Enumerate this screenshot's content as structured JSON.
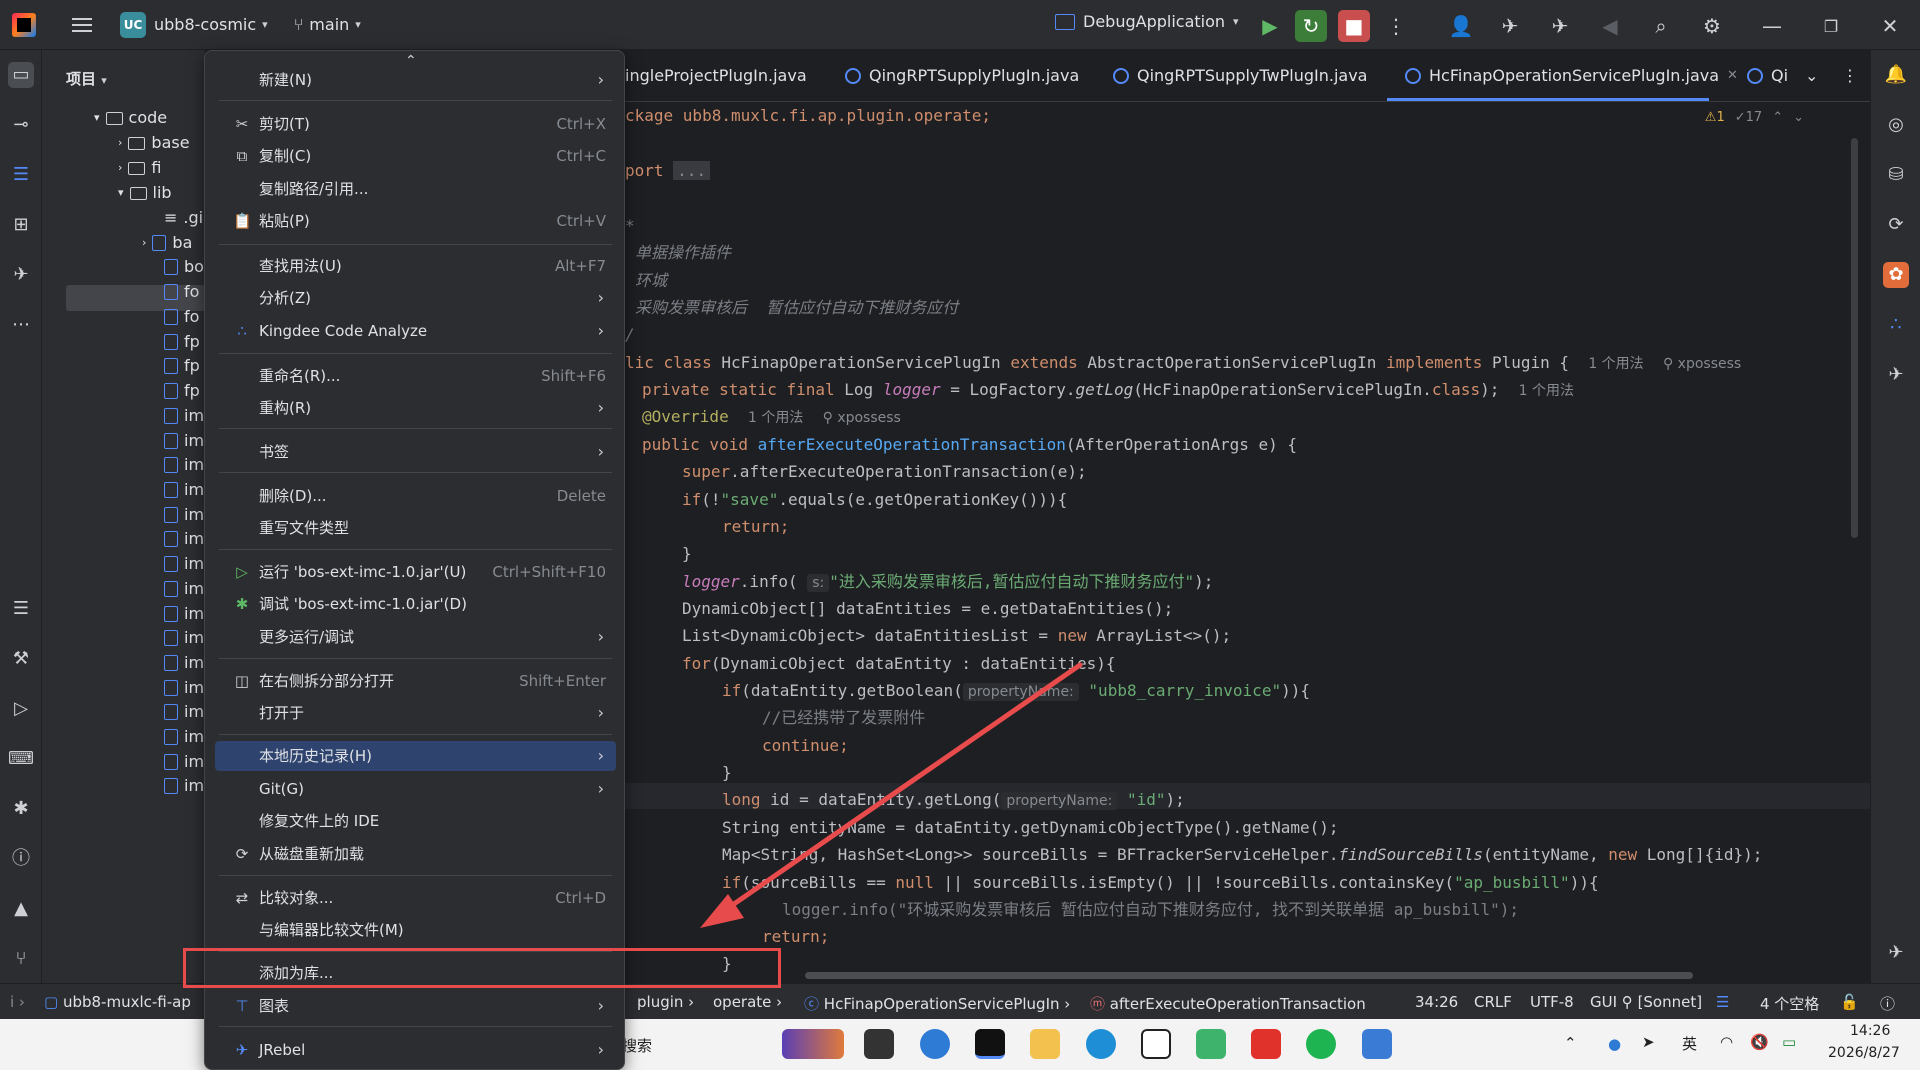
{
  "titlebar": {
    "project_badge": "UC",
    "project_name": "ubb8-cosmic",
    "branch": "main",
    "run_config": "DebugApplication"
  },
  "project_panel": {
    "header": "项目",
    "tree": [
      {
        "label": "code"
      },
      {
        "label": "base"
      },
      {
        "label": "fi"
      },
      {
        "label": "lib"
      },
      {
        "label": ".gi"
      },
      {
        "label": "ba"
      },
      {
        "label": "bo"
      },
      {
        "label": "fo"
      },
      {
        "label": "fo"
      },
      {
        "label": "fp"
      },
      {
        "label": "fp"
      },
      {
        "label": "fp"
      },
      {
        "label": "im"
      },
      {
        "label": "im"
      },
      {
        "label": "im"
      },
      {
        "label": "im"
      },
      {
        "label": "im"
      },
      {
        "label": "im"
      },
      {
        "label": "im"
      },
      {
        "label": "im"
      },
      {
        "label": "im"
      },
      {
        "label": "im"
      },
      {
        "label": "im"
      },
      {
        "label": "im"
      },
      {
        "label": "im"
      },
      {
        "label": "im"
      },
      {
        "label": "im"
      },
      {
        "label": "im"
      }
    ]
  },
  "tabs": [
    {
      "label": "ingleProjectPlugIn.java"
    },
    {
      "label": "QingRPTSupplyPlugIn.java"
    },
    {
      "label": "QingRPTSupplyTwPlugIn.java"
    },
    {
      "label": "HcFinapOperationServicePlugIn.java"
    },
    {
      "label": "Qi"
    }
  ],
  "inspections": {
    "warnings": "1",
    "weak": "17"
  },
  "code": {
    "l1": "ckage ubb8.muxlc.fi.ap.plugin.operate;",
    "l2": "port",
    "l2b": "...",
    "l3": "*",
    "l4": "单据操作插件",
    "l5": "环城",
    "l6": "采购发票审核后  暂估应付自动下推财务应付",
    "l7": "/",
    "l8a": "lic class",
    "l8b": " HcFinapOperationServicePlugIn ",
    "l8c": "extends",
    "l8d": " AbstractOperationServicePlugIn ",
    "l8e": "implements",
    "l8f": " Plugin {",
    "l8g": "1 个用法",
    "l8h": "xpossess",
    "l9a": "private static final",
    "l9b": " Log ",
    "l9c": "logger",
    "l9d": " = LogFactory.",
    "l9e": "getLog",
    "l9f": "(HcFinapOperationServicePlugIn.",
    "l9g": "class",
    "l9h": ");",
    "l9i": "1 个用法",
    "l10a": "@Override",
    "l10b": "1 个用法",
    "l10c": "xpossess",
    "l11a": "public void",
    "l11b": " afterExecuteOperationTransaction",
    "l11c": "(AfterOperationArgs e) {",
    "l12a": "super",
    "l12b": ".afterExecuteOperationTransaction(e);",
    "l13a": "if",
    "l13b": "(!",
    "l13c": "\"save\"",
    "l13d": ".equals(e.getOperationKey())){",
    "l14": "return;",
    "l15": "}",
    "l16a": "logger",
    "l16b": ".info(",
    "l16c": "s:",
    "l16d": "\"进入采购发票审核后,暂估应付自动下推财务应付\"",
    "l16e": ");",
    "l17": "DynamicObject[] dataEntities = e.getDataEntities();",
    "l18a": "List<DynamicObject> dataEntitiesList = ",
    "l18b": "new",
    "l18c": " ArrayList<>();",
    "l19a": "for",
    "l19b": "(DynamicObject dataEntity : dataEntities){",
    "l20a": "if",
    "l20b": "(dataEntity.getBoolean(",
    "l20c": "propertyName:",
    "l20d": "\"ubb8_carry_invoice\"",
    "l20e": ")){",
    "l21": "//已经携带了发票附件",
    "l22": "continue;",
    "l23": "}",
    "l24a": "long",
    "l24b": " id = dataEntity.getLong(",
    "l24c": "propertyName:",
    "l24d": "\"id\"",
    "l24e": ");",
    "l25": "String entityName = dataEntity.getDynamicObjectType().getName();",
    "l26a": "Map<String, HashSet<Long>> sourceBills = BFTrackerServiceHelper.",
    "l26b": "findSourceBills",
    "l26c": "(entityName, ",
    "l26d": "new",
    "l26e": " Long[]{id});",
    "l27a": "if",
    "l27b": "(sourceBills == ",
    "l27c": "null",
    "l27d": " || sourceBills.isEmpty() || !sourceBills.containsKey(",
    "l27e": "\"ap_busbill\"",
    "l27f": ")){",
    "l28": "logger.info(\"环城采购发票审核后 暂估应付自动下推财务应付, 找不到关联单据 ap_busbill\");",
    "l29": "return;",
    "l30": "}"
  },
  "context_menu": {
    "items": [
      {
        "label": "新建(N)"
      },
      {
        "label": "剪切(T)",
        "shortcut": "Ctrl+X"
      },
      {
        "label": "复制(C)",
        "shortcut": "Ctrl+C"
      },
      {
        "label": "复制路径/引用..."
      },
      {
        "label": "粘贴(P)",
        "shortcut": "Ctrl+V"
      },
      {
        "label": "查找用法(U)",
        "shortcut": "Alt+F7"
      },
      {
        "label": "分析(Z)"
      },
      {
        "label": "Kingdee Code Analyze"
      },
      {
        "label": "重命名(R)...",
        "shortcut": "Shift+F6"
      },
      {
        "label": "重构(R)"
      },
      {
        "label": "书签"
      },
      {
        "label": "删除(D)...",
        "shortcut": "Delete"
      },
      {
        "label": "重写文件类型"
      },
      {
        "label": "运行 'bos-ext-imc-1.0.jar'(U)",
        "shortcut": "Ctrl+Shift+F10"
      },
      {
        "label": "调试 'bos-ext-imc-1.0.jar'(D)"
      },
      {
        "label": "更多运行/调试"
      },
      {
        "label": "在右侧拆分部分打开",
        "shortcut": "Shift+Enter"
      },
      {
        "label": "打开于"
      },
      {
        "label": "本地历史记录(H)"
      },
      {
        "label": "Git(G)"
      },
      {
        "label": "修复文件上的 IDE"
      },
      {
        "label": "从磁盘重新加载"
      },
      {
        "label": "比较对象...",
        "shortcut": "Ctrl+D"
      },
      {
        "label": "与编辑器比较文件(M)"
      },
      {
        "label": "添加为库..."
      },
      {
        "label": "图表"
      },
      {
        "label": "JRebel"
      }
    ]
  },
  "statusbar": {
    "project": "ubb8-muxlc-fi-ap",
    "crumb_plugin": "plugin",
    "crumb_operate": "operate",
    "crumb_class": "HcFinapOperationServicePlugIn",
    "crumb_method": "afterExecuteOperationTransaction",
    "position": "34:26",
    "line_sep": "CRLF",
    "encoding": "UTF-8",
    "ai": "GUI",
    "model": "[Sonnet]",
    "indent": "4 个空格"
  },
  "taskbar": {
    "search": "搜索",
    "ime": "英",
    "time": "14:26",
    "date": "2026/8/27"
  },
  "colors": {
    "highlight": "#2e436e",
    "annotation": "#e84b4b",
    "accent": "#548af7"
  }
}
